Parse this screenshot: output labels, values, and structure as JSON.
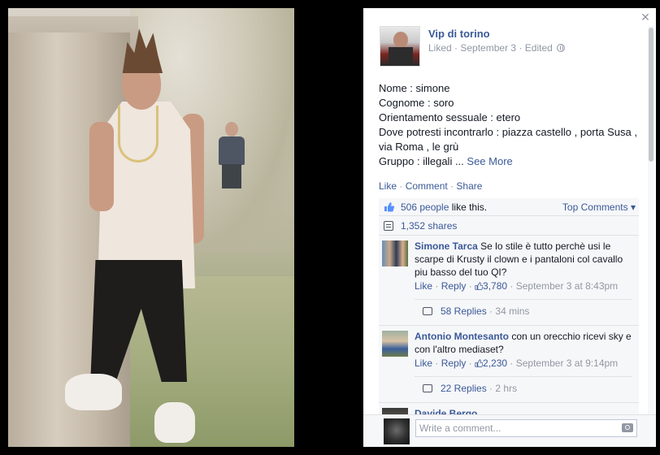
{
  "post": {
    "page_name": "Vip di torino",
    "meta_liked": "Liked",
    "meta_date": "September 3",
    "meta_edited": "Edited",
    "body_lines": [
      "Nome : simone",
      "Cognome : soro",
      "Orientamento sessuale : etero",
      "Dove potresti incontrarlo : piazza castello , porta Susa ,",
      "via Roma , le grù"
    ],
    "body_last_line": "Gruppo : illegali ...",
    "see_more": "See More"
  },
  "actions": {
    "like": "Like",
    "comment": "Comment",
    "share": "Share",
    "separator": "·"
  },
  "ufi": {
    "likes_count": "506 people",
    "likes_suffix": "like this.",
    "top_comments": "Top Comments",
    "shares": "1,352 shares"
  },
  "comments": [
    {
      "author": "Simone Tarca",
      "text": "Se lo stile è tutto perchè usi le scarpe di Krusty il clown e i pantaloni col cavallo piu basso del tuo QI?",
      "like": "Like",
      "reply": "Reply",
      "likes": "3,780",
      "time": "September 3 at 8:43pm",
      "replies": "58 Replies",
      "replies_time": "34 mins"
    },
    {
      "author": "Antonio Montesanto",
      "text": "con un orecchio ricevi sky e con l'altro mediaset?",
      "like": "Like",
      "reply": "Reply",
      "likes": "2,230",
      "time": "September 3 at 9:14pm",
      "replies": "22 Replies",
      "replies_time": "2 hrs"
    },
    {
      "author": "Davide Bergo"
    }
  ],
  "composer": {
    "placeholder": "Write a comment..."
  },
  "colors": {
    "link": "#3b5998",
    "muted": "#9197a3",
    "ufi_bg": "#f6f7f9"
  },
  "icons": [
    "close-icon",
    "globe-icon",
    "like-thumb-icon",
    "share-icon",
    "reply-icon",
    "camera-icon"
  ]
}
